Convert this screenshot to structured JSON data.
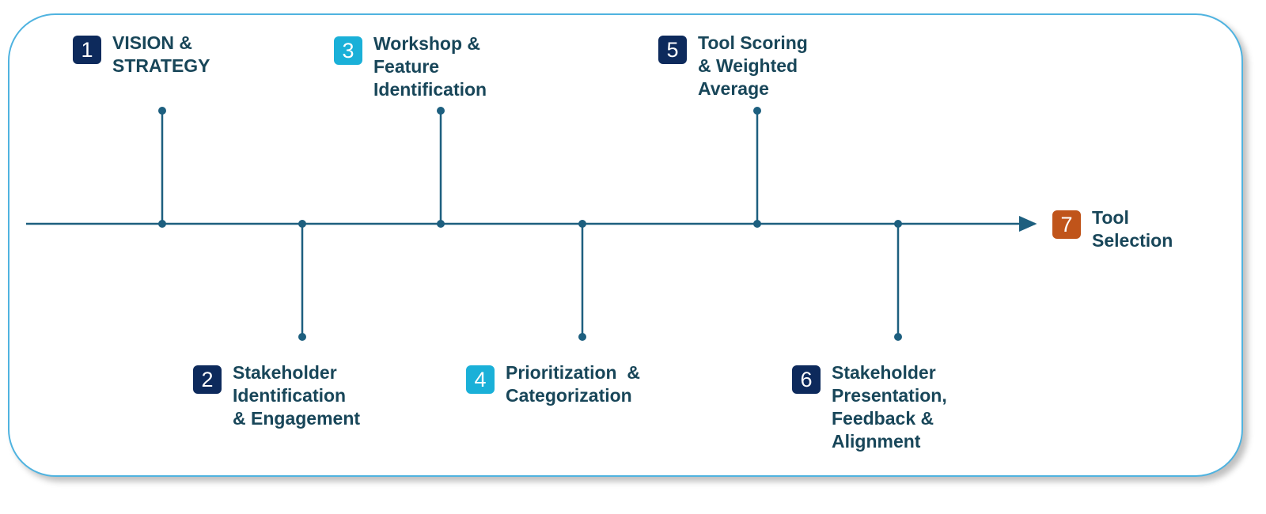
{
  "colors": {
    "navy": "#0d2a5c",
    "cyan": "#1ab0d8",
    "orange": "#c0541a",
    "line": "#1d5f7f",
    "text": "#184659",
    "border": "#4fb3e0"
  },
  "steps": [
    {
      "num": "1",
      "label": "VISION &\nSTRATEGY",
      "color": "navy",
      "position": "above"
    },
    {
      "num": "2",
      "label": "Stakeholder\nIdentification\n& Engagement",
      "color": "navy",
      "position": "below"
    },
    {
      "num": "3",
      "label": "Workshop &\nFeature\nIdentification",
      "color": "cyan",
      "position": "above"
    },
    {
      "num": "4",
      "label": "Prioritization  &\nCategorization",
      "color": "cyan",
      "position": "below"
    },
    {
      "num": "5",
      "label": "Tool Scoring\n& Weighted\nAverage",
      "color": "navy",
      "position": "above"
    },
    {
      "num": "6",
      "label": "Stakeholder\nPresentation,\nFeedback &\nAlignment",
      "color": "navy",
      "position": "below"
    },
    {
      "num": "7",
      "label": "Tool\nSelection",
      "color": "orange",
      "position": "end"
    }
  ]
}
